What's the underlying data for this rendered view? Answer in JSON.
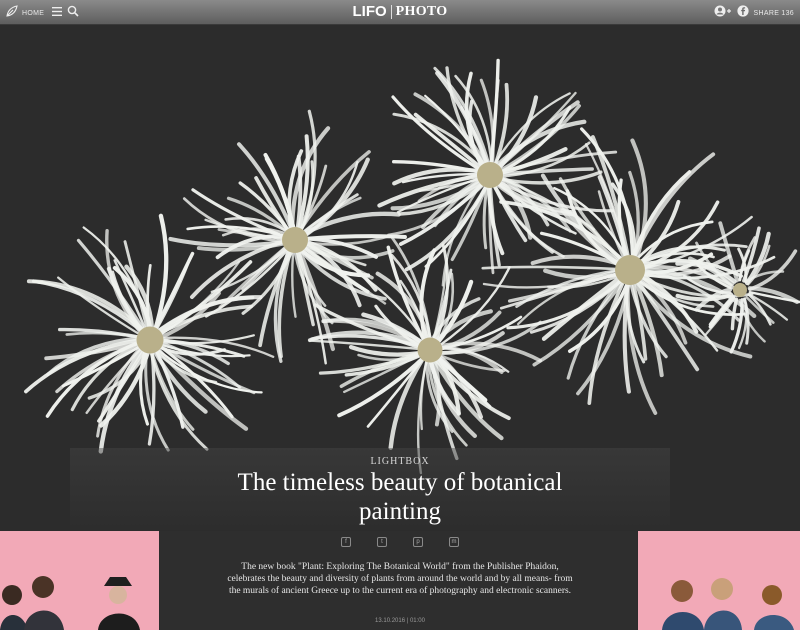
{
  "header": {
    "home_label": "HOME",
    "logo": "LIFO",
    "section": "PHOTO",
    "share_label": "SHARE 136"
  },
  "icons": {
    "home": "leaf-home-icon",
    "menu": "hamburger-menu-icon",
    "search": "search-icon",
    "user": "user-add-icon",
    "facebook": "facebook-icon"
  },
  "article": {
    "category": "LIGHTBOX",
    "title": "The timeless beauty of botanical painting",
    "description": "The new book \"Plant: Exploring The Botanical World\" from the Publisher Phaidon, celebrates the beauty and diversity of plants from around the world and by all means- from the murals of ancient Greece up to the current era of photography and electronic scanners.",
    "date": "13.10.2016 | 01:00"
  },
  "share_buttons": [
    "f",
    "t",
    "p",
    "m"
  ],
  "colors": {
    "background": "#2b2b2b",
    "ad_pink": "#f2a9b7",
    "flower": "#f0f2ee"
  }
}
